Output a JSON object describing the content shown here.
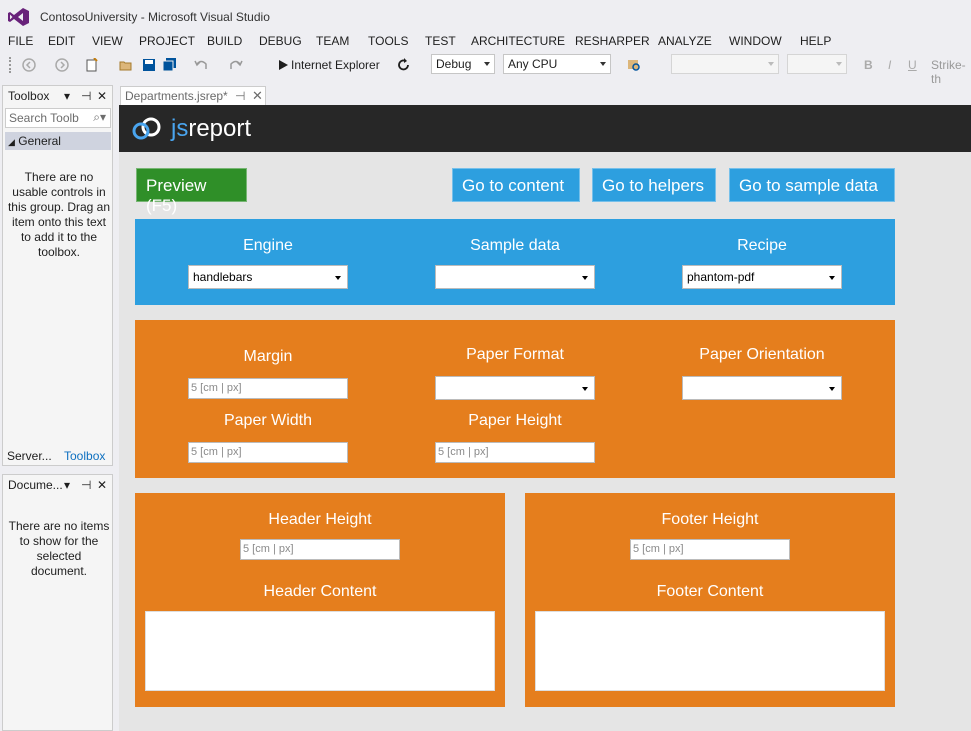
{
  "window": {
    "title": "ContosoUniversity - Microsoft Visual Studio"
  },
  "menu": [
    "FILE",
    "EDIT",
    "VIEW",
    "PROJECT",
    "BUILD",
    "DEBUG",
    "TEAM",
    "TOOLS",
    "TEST",
    "ARCHITECTURE",
    "RESHARPER",
    "ANALYZE",
    "WINDOW",
    "HELP"
  ],
  "toolbar": {
    "browser_label": "Internet Explorer",
    "config": "Debug",
    "platform": "Any CPU",
    "strike_label": "Strike-th",
    "format_bold": "B",
    "format_italic": "I",
    "format_underline": "U"
  },
  "toolbox": {
    "title": "Toolbox",
    "search_placeholder": "Search Toolb",
    "group": "General",
    "empty_message": "There are no usable controls in this group. Drag an item onto this text to add it to the toolbox.",
    "tabs": [
      "Server...",
      "Toolbox"
    ]
  },
  "docoutline": {
    "title": "Docume...",
    "empty_message": "There are no items to show for the selected document."
  },
  "doc_tab": {
    "label": "Departments.jsrep*"
  },
  "jsreport": {
    "logo_js": "js",
    "logo_report": "report",
    "preview_button": "Preview (F5)",
    "nav_buttons": [
      "Go to content",
      "Go to helpers",
      "Go to sample data"
    ],
    "engine": {
      "label": "Engine",
      "value": "handlebars"
    },
    "sample_data": {
      "label": "Sample data",
      "value": ""
    },
    "recipe": {
      "label": "Recipe",
      "value": "phantom-pdf"
    },
    "margin": {
      "label": "Margin",
      "placeholder": "5 [cm | px]"
    },
    "paper_format": {
      "label": "Paper Format",
      "value": ""
    },
    "paper_orientation": {
      "label": "Paper Orientation",
      "value": ""
    },
    "paper_width": {
      "label": "Paper Width",
      "placeholder": "5 [cm | px]"
    },
    "paper_height": {
      "label": "Paper Height",
      "placeholder": "5 [cm | px]"
    },
    "header_height": {
      "label": "Header Height",
      "placeholder": "5 [cm | px]"
    },
    "header_content": {
      "label": "Header Content"
    },
    "footer_height": {
      "label": "Footer Height",
      "placeholder": "5 [cm | px]"
    },
    "footer_content": {
      "label": "Footer Content"
    }
  },
  "colors": {
    "accent_blue": "#2d9fdf",
    "accent_orange": "#e57e1d",
    "preview_green": "#2f8f28",
    "vs_purple": "#68217a"
  }
}
